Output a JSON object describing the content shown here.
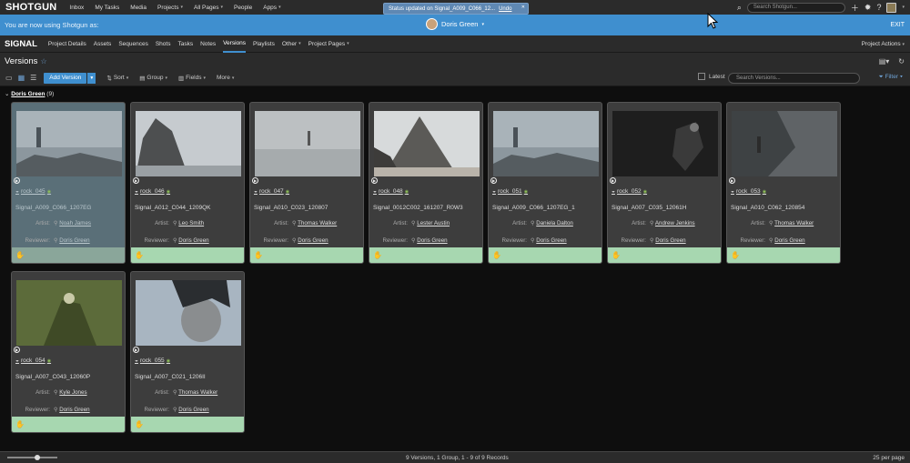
{
  "topnav": {
    "logo": "SHOTGUN",
    "items": [
      {
        "label": "Inbox",
        "caret": false
      },
      {
        "label": "My Tasks",
        "caret": false
      },
      {
        "label": "Media",
        "caret": false
      },
      {
        "label": "Projects",
        "caret": true
      },
      {
        "label": "All Pages",
        "caret": true
      },
      {
        "label": "People",
        "caret": false
      },
      {
        "label": "Apps",
        "caret": true
      }
    ],
    "search_placeholder": "Search Shotgun..."
  },
  "toast": {
    "message": "Status updated on Signal_A009_C066_12...",
    "undo": "Undo"
  },
  "userbar": {
    "message": "You are now using Shotgun as:",
    "user": "Doris Green",
    "exit": "EXIT"
  },
  "projbar": {
    "name": "SIGNAL",
    "tabs": [
      {
        "label": "Project Details",
        "caret": false,
        "active": false
      },
      {
        "label": "Assets",
        "caret": false,
        "active": false
      },
      {
        "label": "Sequences",
        "caret": false,
        "active": false
      },
      {
        "label": "Shots",
        "caret": false,
        "active": false
      },
      {
        "label": "Tasks",
        "caret": false,
        "active": false
      },
      {
        "label": "Notes",
        "caret": false,
        "active": false
      },
      {
        "label": "Versions",
        "caret": false,
        "active": true
      },
      {
        "label": "Playlists",
        "caret": false,
        "active": false
      },
      {
        "label": "Other",
        "caret": true,
        "active": false
      },
      {
        "label": "Project Pages",
        "caret": true,
        "active": false
      }
    ],
    "actions": "Project Actions"
  },
  "page": {
    "title": "Versions"
  },
  "toolbar": {
    "add": "Add Version",
    "tools": [
      "Sort",
      "Group",
      "Fields",
      "More"
    ],
    "latest": "Latest",
    "search_placeholder": "Search Versions...",
    "filter": "Filter"
  },
  "group": {
    "name": "Doris Green",
    "count": "(9)"
  },
  "labels": {
    "artist": "Artist:",
    "reviewer": "Reviewer:"
  },
  "cards": [
    {
      "name": "rock_045",
      "code": "Signal_A009_C066_1207EG",
      "artist": "Noah James",
      "reviewer": "Doris Green",
      "selected": true,
      "scene": "sea"
    },
    {
      "name": "rock_046",
      "code": "Signal_A012_C044_1209QK",
      "artist": "Leo Smith",
      "reviewer": "Doris Green",
      "selected": false,
      "scene": "rock"
    },
    {
      "name": "rock_047",
      "code": "Signal_A010_C023_120807",
      "artist": "Thomas Walker",
      "reviewer": "Doris Green",
      "selected": false,
      "scene": "fog"
    },
    {
      "name": "rock_048",
      "code": "Signal_0012C002_161207_R0W3",
      "artist": "Lester Austin",
      "reviewer": "Doris Green",
      "selected": false,
      "scene": "peak"
    },
    {
      "name": "rock_051",
      "code": "Signal_A009_C066_1207EG_1",
      "artist": "Daniela Dalton",
      "reviewer": "Doris Green",
      "selected": false,
      "scene": "sea"
    },
    {
      "name": "rock_052",
      "code": "Signal_A007_C035_12061H",
      "artist": "Andrew Jenkins",
      "reviewer": "Doris Green",
      "selected": false,
      "scene": "dark"
    },
    {
      "name": "rock_053",
      "code": "Signal_A010_C062_120854",
      "artist": "Thomas Walker",
      "reviewer": "Doris Green",
      "selected": false,
      "scene": "cliff"
    },
    {
      "name": "rock_054",
      "code": "Signal_A007_C043_12060P",
      "artist": "Kyle Jones",
      "reviewer": "Doris Green",
      "selected": false,
      "scene": "green"
    },
    {
      "name": "rock_055",
      "code": "Signal_A007_C021_1206II",
      "artist": "Thomas Walker",
      "reviewer": "Doris Green",
      "selected": false,
      "scene": "face"
    }
  ],
  "footer": {
    "records": "9 Versions, 1 Group, 1 - 9 of 9 Records",
    "per_page": "25 per page"
  },
  "colors": {
    "accent": "#3f8fcf",
    "status_green": "#a7d7b0",
    "card_bg": "#3d3d3d"
  }
}
